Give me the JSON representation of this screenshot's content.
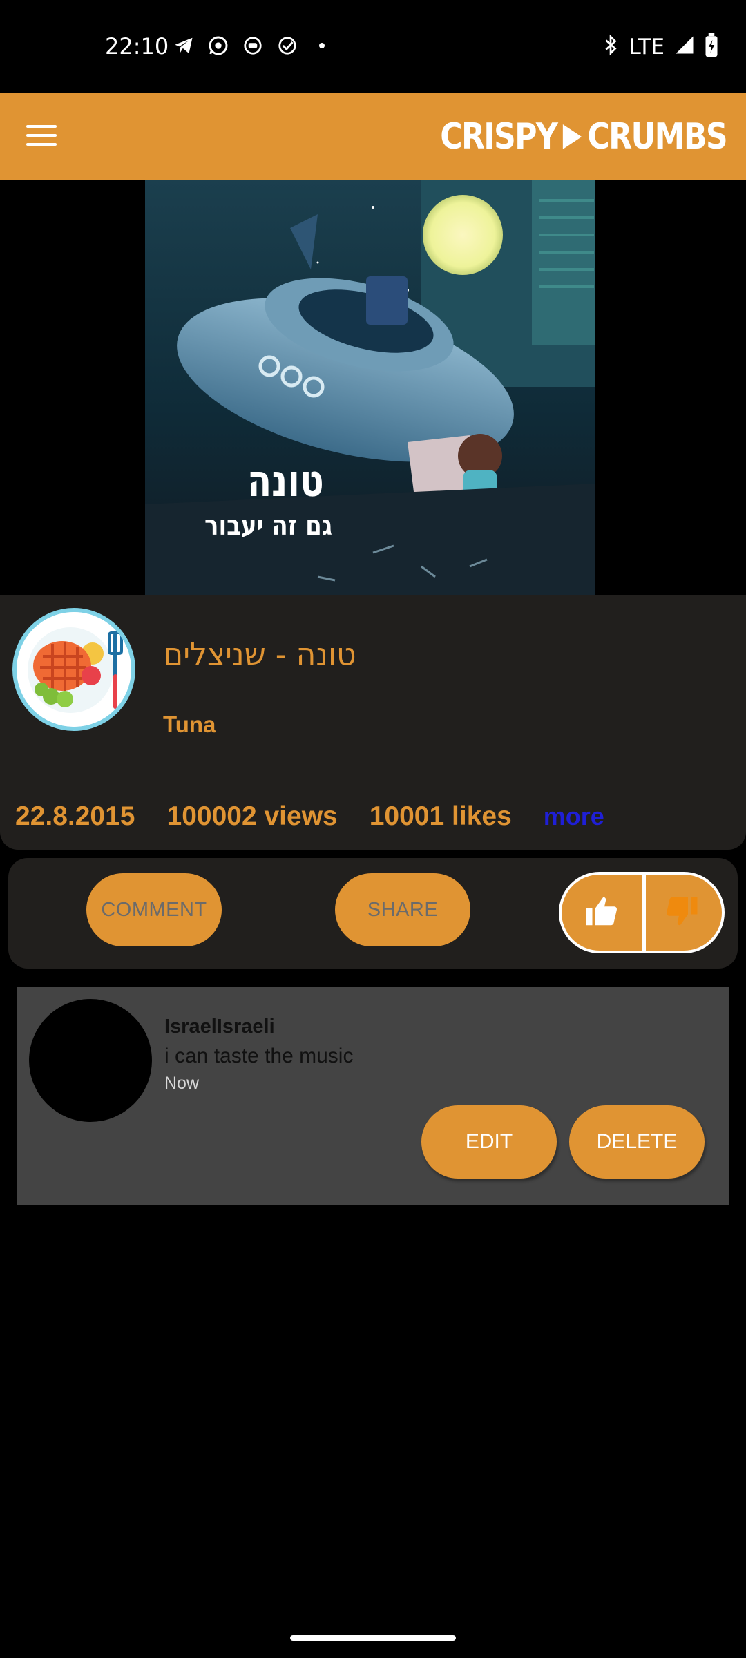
{
  "status_bar": {
    "time": "22:10",
    "left_icons": [
      "telegram-icon",
      "whatsapp-icon",
      "app-icon",
      "check-circle-icon",
      "dot-icon"
    ],
    "network": "LTE",
    "right_icons": [
      "bluetooth-icon",
      "signal-icon",
      "battery-charging-icon"
    ]
  },
  "app_bar": {
    "menu_icon": "hamburger-icon",
    "logo_left": "CRISPY",
    "logo_right": "CRUMBS",
    "brand_color": "#e09433"
  },
  "video": {
    "overlay_title": "טונה",
    "overlay_subtitle": "גם זה יעבור"
  },
  "info": {
    "title": "טונה - שניצלים",
    "channel": "Tuna",
    "date": "22.8.2015",
    "views": "100002 views",
    "likes": "10001 likes",
    "more": "more"
  },
  "actions": {
    "comment": "COMMENT",
    "share": "SHARE",
    "like_icon": "thumbs-up-icon",
    "dislike_icon": "thumbs-down-icon"
  },
  "comments": [
    {
      "user": "IsraelIsraeli",
      "text": "i can taste the music",
      "time": "Now",
      "edit": "EDIT",
      "delete": "DELETE"
    }
  ]
}
